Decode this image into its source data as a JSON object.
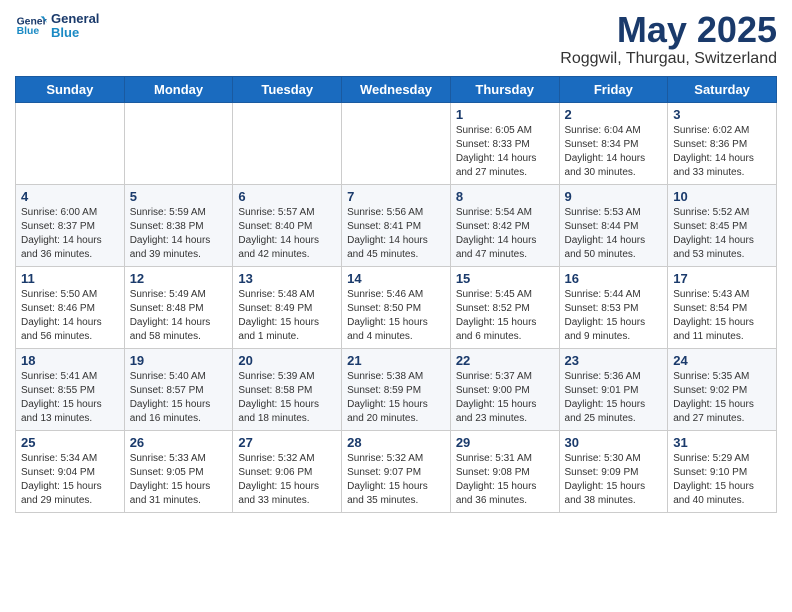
{
  "logo": {
    "line1": "General",
    "line2": "Blue"
  },
  "title": "May 2025",
  "location": "Roggwil, Thurgau, Switzerland",
  "days_of_week": [
    "Sunday",
    "Monday",
    "Tuesday",
    "Wednesday",
    "Thursday",
    "Friday",
    "Saturday"
  ],
  "weeks": [
    [
      {
        "day": "",
        "info": ""
      },
      {
        "day": "",
        "info": ""
      },
      {
        "day": "",
        "info": ""
      },
      {
        "day": "",
        "info": ""
      },
      {
        "day": "1",
        "info": "Sunrise: 6:05 AM\nSunset: 8:33 PM\nDaylight: 14 hours\nand 27 minutes."
      },
      {
        "day": "2",
        "info": "Sunrise: 6:04 AM\nSunset: 8:34 PM\nDaylight: 14 hours\nand 30 minutes."
      },
      {
        "day": "3",
        "info": "Sunrise: 6:02 AM\nSunset: 8:36 PM\nDaylight: 14 hours\nand 33 minutes."
      }
    ],
    [
      {
        "day": "4",
        "info": "Sunrise: 6:00 AM\nSunset: 8:37 PM\nDaylight: 14 hours\nand 36 minutes."
      },
      {
        "day": "5",
        "info": "Sunrise: 5:59 AM\nSunset: 8:38 PM\nDaylight: 14 hours\nand 39 minutes."
      },
      {
        "day": "6",
        "info": "Sunrise: 5:57 AM\nSunset: 8:40 PM\nDaylight: 14 hours\nand 42 minutes."
      },
      {
        "day": "7",
        "info": "Sunrise: 5:56 AM\nSunset: 8:41 PM\nDaylight: 14 hours\nand 45 minutes."
      },
      {
        "day": "8",
        "info": "Sunrise: 5:54 AM\nSunset: 8:42 PM\nDaylight: 14 hours\nand 47 minutes."
      },
      {
        "day": "9",
        "info": "Sunrise: 5:53 AM\nSunset: 8:44 PM\nDaylight: 14 hours\nand 50 minutes."
      },
      {
        "day": "10",
        "info": "Sunrise: 5:52 AM\nSunset: 8:45 PM\nDaylight: 14 hours\nand 53 minutes."
      }
    ],
    [
      {
        "day": "11",
        "info": "Sunrise: 5:50 AM\nSunset: 8:46 PM\nDaylight: 14 hours\nand 56 minutes."
      },
      {
        "day": "12",
        "info": "Sunrise: 5:49 AM\nSunset: 8:48 PM\nDaylight: 14 hours\nand 58 minutes."
      },
      {
        "day": "13",
        "info": "Sunrise: 5:48 AM\nSunset: 8:49 PM\nDaylight: 15 hours\nand 1 minute."
      },
      {
        "day": "14",
        "info": "Sunrise: 5:46 AM\nSunset: 8:50 PM\nDaylight: 15 hours\nand 4 minutes."
      },
      {
        "day": "15",
        "info": "Sunrise: 5:45 AM\nSunset: 8:52 PM\nDaylight: 15 hours\nand 6 minutes."
      },
      {
        "day": "16",
        "info": "Sunrise: 5:44 AM\nSunset: 8:53 PM\nDaylight: 15 hours\nand 9 minutes."
      },
      {
        "day": "17",
        "info": "Sunrise: 5:43 AM\nSunset: 8:54 PM\nDaylight: 15 hours\nand 11 minutes."
      }
    ],
    [
      {
        "day": "18",
        "info": "Sunrise: 5:41 AM\nSunset: 8:55 PM\nDaylight: 15 hours\nand 13 minutes."
      },
      {
        "day": "19",
        "info": "Sunrise: 5:40 AM\nSunset: 8:57 PM\nDaylight: 15 hours\nand 16 minutes."
      },
      {
        "day": "20",
        "info": "Sunrise: 5:39 AM\nSunset: 8:58 PM\nDaylight: 15 hours\nand 18 minutes."
      },
      {
        "day": "21",
        "info": "Sunrise: 5:38 AM\nSunset: 8:59 PM\nDaylight: 15 hours\nand 20 minutes."
      },
      {
        "day": "22",
        "info": "Sunrise: 5:37 AM\nSunset: 9:00 PM\nDaylight: 15 hours\nand 23 minutes."
      },
      {
        "day": "23",
        "info": "Sunrise: 5:36 AM\nSunset: 9:01 PM\nDaylight: 15 hours\nand 25 minutes."
      },
      {
        "day": "24",
        "info": "Sunrise: 5:35 AM\nSunset: 9:02 PM\nDaylight: 15 hours\nand 27 minutes."
      }
    ],
    [
      {
        "day": "25",
        "info": "Sunrise: 5:34 AM\nSunset: 9:04 PM\nDaylight: 15 hours\nand 29 minutes."
      },
      {
        "day": "26",
        "info": "Sunrise: 5:33 AM\nSunset: 9:05 PM\nDaylight: 15 hours\nand 31 minutes."
      },
      {
        "day": "27",
        "info": "Sunrise: 5:32 AM\nSunset: 9:06 PM\nDaylight: 15 hours\nand 33 minutes."
      },
      {
        "day": "28",
        "info": "Sunrise: 5:32 AM\nSunset: 9:07 PM\nDaylight: 15 hours\nand 35 minutes."
      },
      {
        "day": "29",
        "info": "Sunrise: 5:31 AM\nSunset: 9:08 PM\nDaylight: 15 hours\nand 36 minutes."
      },
      {
        "day": "30",
        "info": "Sunrise: 5:30 AM\nSunset: 9:09 PM\nDaylight: 15 hours\nand 38 minutes."
      },
      {
        "day": "31",
        "info": "Sunrise: 5:29 AM\nSunset: 9:10 PM\nDaylight: 15 hours\nand 40 minutes."
      }
    ]
  ]
}
